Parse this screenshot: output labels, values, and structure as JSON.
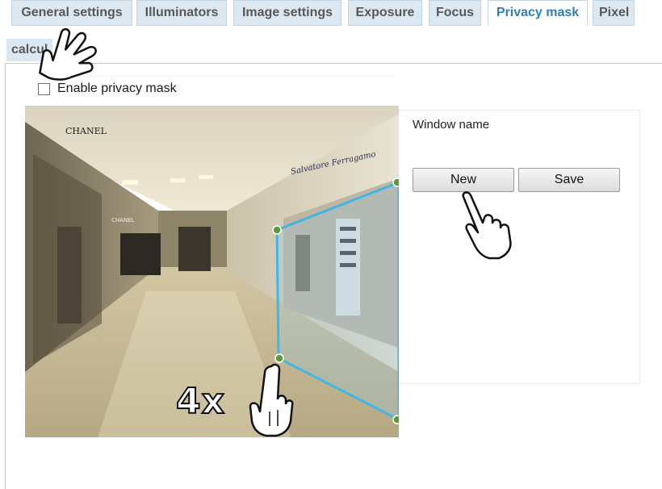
{
  "tabs": [
    {
      "label": "General settings",
      "active": false
    },
    {
      "label": "Illuminators",
      "active": false
    },
    {
      "label": "Image settings",
      "active": false
    },
    {
      "label": "Exposure",
      "active": false
    },
    {
      "label": "Focus",
      "active": false
    },
    {
      "label": "Privacy mask",
      "active": true
    },
    {
      "label": "Pixel",
      "active": false
    }
  ],
  "tab_overflow": "calcul",
  "privacy": {
    "enable_label": "Enable privacy mask",
    "enabled": false
  },
  "preview": {
    "store_sign_main": "CHANEL",
    "store_sign_far": "CHANEL",
    "store_sign_right": "Salvatore Ferragamo",
    "mask_color": "#3fb6e6",
    "handle_color": "#5c9a3c"
  },
  "window_panel": {
    "window_name_label": "Window name",
    "new_button": "New",
    "save_button": "Save"
  },
  "annotation": {
    "zoom_text": "4x"
  },
  "icons": [
    "hand-pointer-icon"
  ],
  "colors": {
    "tab_bg": "#dbe8f1",
    "tab_active_text": "#2f7fb7",
    "tab_text": "#585858"
  }
}
